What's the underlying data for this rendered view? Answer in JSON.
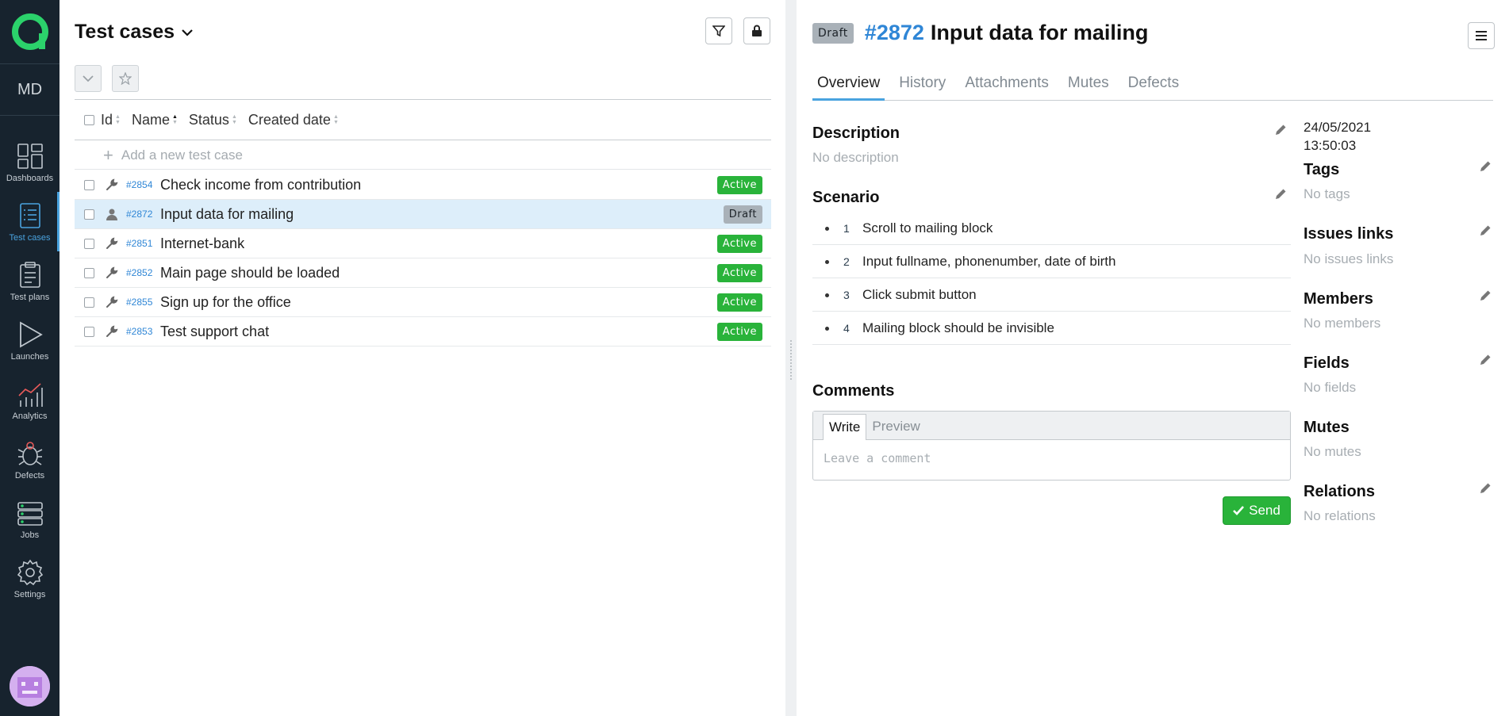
{
  "nav": {
    "initials": "MD",
    "items": [
      {
        "label": "Dashboards",
        "icon": "dashboards-icon"
      },
      {
        "label": "Test cases",
        "icon": "test-cases-icon",
        "active": true
      },
      {
        "label": "Test plans",
        "icon": "test-plans-icon"
      },
      {
        "label": "Launches",
        "icon": "launches-icon"
      },
      {
        "label": "Analytics",
        "icon": "analytics-icon"
      },
      {
        "label": "Defects",
        "icon": "bug-icon"
      },
      {
        "label": "Jobs",
        "icon": "jobs-icon"
      },
      {
        "label": "Settings",
        "icon": "gear-icon"
      }
    ]
  },
  "list": {
    "title": "Test cases",
    "columns": [
      "Id",
      "Name",
      "Status",
      "Created date"
    ],
    "add_placeholder": "Add a new test case",
    "rows": [
      {
        "id": "#2854",
        "name": "Check income from contribution",
        "status": "Active",
        "icon": "wrench-icon"
      },
      {
        "id": "#2872",
        "name": "Input data for mailing",
        "status": "Draft",
        "icon": "user-icon",
        "selected": true
      },
      {
        "id": "#2851",
        "name": "Internet-bank",
        "status": "Active",
        "icon": "wrench-icon"
      },
      {
        "id": "#2852",
        "name": "Main page should be loaded",
        "status": "Active",
        "icon": "wrench-icon"
      },
      {
        "id": "#2855",
        "name": "Sign up for the office",
        "status": "Active",
        "icon": "wrench-icon"
      },
      {
        "id": "#2853",
        "name": "Test support chat",
        "status": "Active",
        "icon": "wrench-icon"
      }
    ]
  },
  "detail": {
    "status": "Draft",
    "id": "#2872",
    "title": "Input data for mailing",
    "tabs": [
      "Overview",
      "History",
      "Attachments",
      "Mutes",
      "Defects"
    ],
    "description_title": "Description",
    "description_empty": "No description",
    "scenario_title": "Scenario",
    "steps": [
      {
        "num": "1",
        "text": "Scroll to mailing block"
      },
      {
        "num": "2",
        "text": "Input fullname, phonenumber, date of birth"
      },
      {
        "num": "3",
        "text": "Click submit button"
      },
      {
        "num": "4",
        "text": "Mailing block should be invisible"
      }
    ],
    "comments_title": "Comments",
    "comment_tabs": [
      "Write",
      "Preview"
    ],
    "comment_placeholder": "Leave a comment",
    "send_label": "Send",
    "created_date": "24/05/2021",
    "created_time": "13:50:03",
    "side": [
      {
        "title": "Tags",
        "empty": "No tags"
      },
      {
        "title": "Issues links",
        "empty": "No issues links"
      },
      {
        "title": "Members",
        "empty": "No members"
      },
      {
        "title": "Fields",
        "empty": "No fields"
      },
      {
        "title": "Mutes",
        "empty": "No mutes"
      },
      {
        "title": "Relations",
        "empty": "No relations"
      }
    ]
  },
  "colors": {
    "nav_bg": "#17232e",
    "accent": "#4aa3df",
    "link": "#2f86d6",
    "active_badge": "#29b33a",
    "draft_badge": "#a9b1b8",
    "selected_row": "#ddeefa"
  }
}
